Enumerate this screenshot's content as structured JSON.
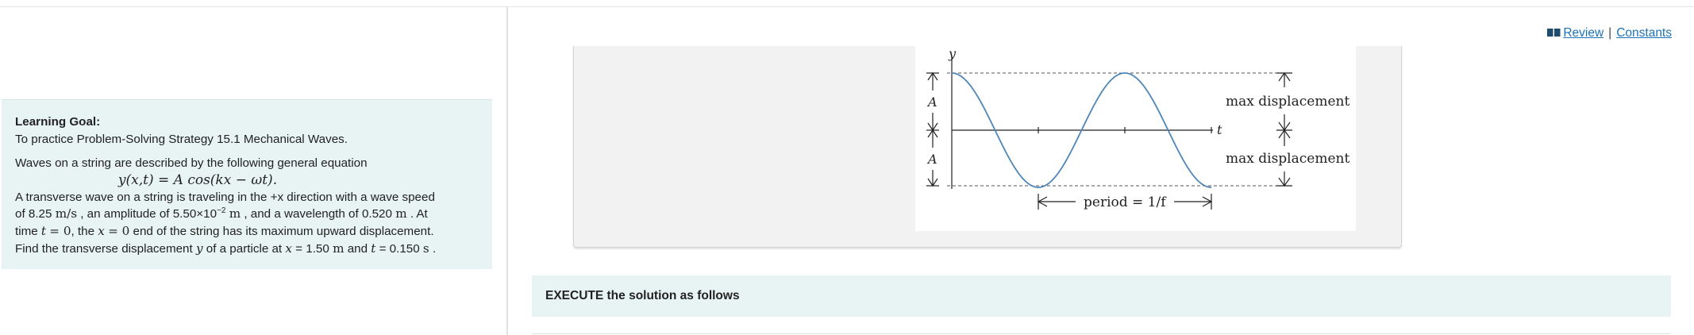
{
  "header": {
    "review_label": "Review",
    "separator": "|",
    "constants_label": "Constants",
    "link_color": "#1c72b8"
  },
  "goal": {
    "title": "Learning Goal:",
    "subtitle": "To practice Problem-Solving Strategy 15.1 Mechanical Waves.",
    "intro": "Waves on a string are described by the following general equation",
    "equation": "y(x,t) = A cos(kx − ωt).",
    "p1": "A transverse wave on a string is traveling in the +x direction with a wave speed",
    "speed_value": "8.25",
    "speed_unit": "m/s",
    "amplitude_mantissa": "5.50×10",
    "amplitude_exp": "−2",
    "amplitude_unit": "m",
    "wavelength_value": "0.520",
    "wavelength_unit": "m",
    "x_value": "1.50",
    "x_unit": "m",
    "t_value": "0.150",
    "t_unit": "s",
    "panel_color": "#e8f4f4"
  },
  "figure": {
    "y_axis_label": "y",
    "t_axis_label": "t",
    "amplitude_label_top": "A",
    "amplitude_label_bottom": "A",
    "max_disp_top": "max displacement",
    "max_disp_bottom": "max displacement",
    "period_label": "period = 1/f",
    "curve_color": "#4f86b7"
  },
  "execute": {
    "label": "EXECUTE the solution as follows"
  }
}
